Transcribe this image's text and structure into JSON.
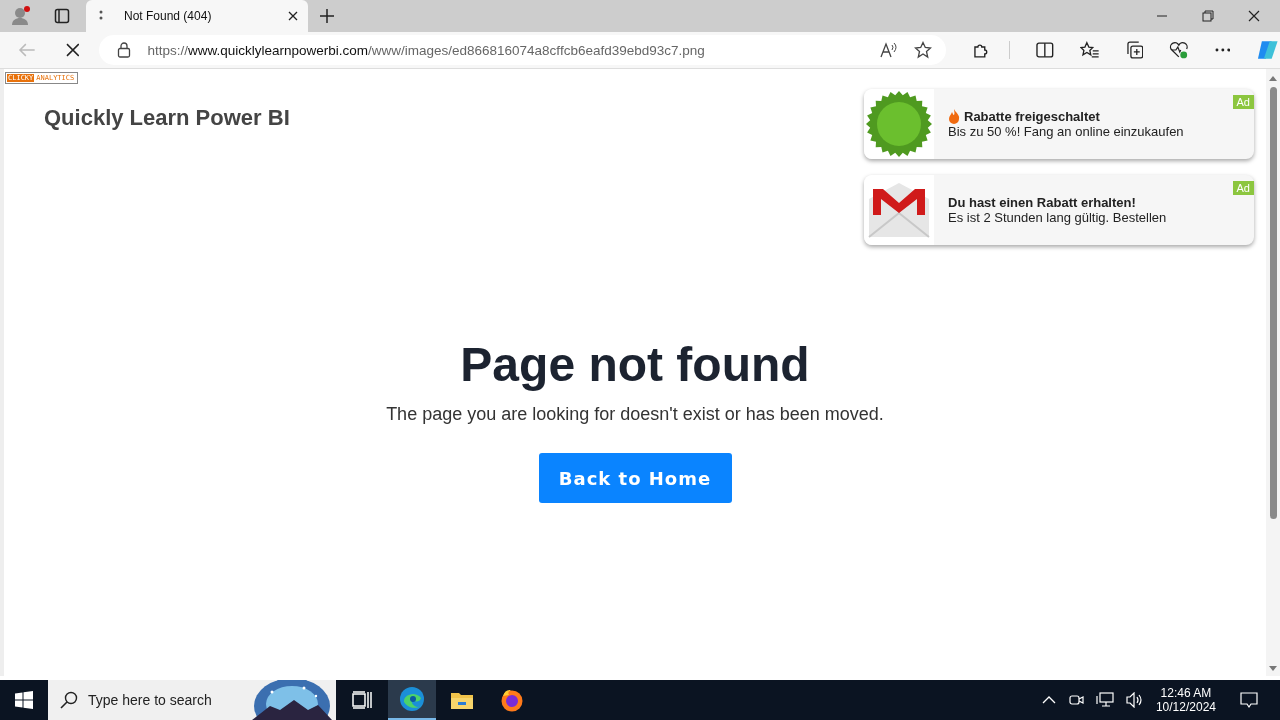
{
  "browser": {
    "tabs": [
      {
        "title": "Not Found (404)",
        "selected": true
      }
    ],
    "url_scheme": "https://",
    "url_host": "www.quicklylearnpowerbi.com",
    "url_path": "/www/images/ed866816074a8cffcb6eafd39ebd93c7.png"
  },
  "page": {
    "badge": [
      "CLICKY",
      "ANALYTICS"
    ],
    "site_title": "Quickly Learn Power BI",
    "heading": "Page not found",
    "message": "The page you are looking for doesn't exist or has been moved.",
    "button": "Back to Home"
  },
  "ads": [
    {
      "kind": "offer",
      "title": "Rabatte freigeschaltet",
      "text": "Bis zu 50 %! Fang an online einzukaufen",
      "label": "Ad"
    },
    {
      "kind": "mail",
      "title": "Du hast einen Rabatt erhalten!",
      "text": "Es ist 2 Stunden lang gültig. Bestellen",
      "label": "Ad"
    }
  ],
  "taskbar": {
    "search_placeholder": "Type here to search",
    "apps": [
      {
        "kind": "taskview",
        "selected": false
      },
      {
        "kind": "edge",
        "selected": true
      },
      {
        "kind": "files",
        "selected": false
      },
      {
        "kind": "firefox",
        "selected": false
      }
    ],
    "time": "12:46 AM",
    "date": "10/12/2024"
  }
}
